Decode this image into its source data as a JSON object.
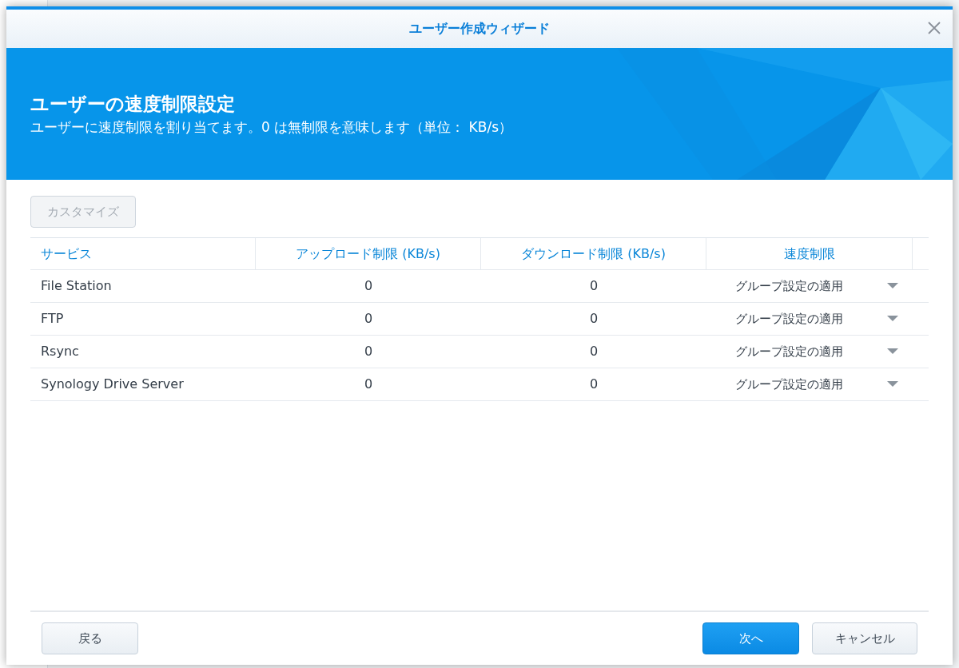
{
  "window": {
    "title": "ユーザー作成ウィザード"
  },
  "header": {
    "title": "ユーザーの速度制限設定",
    "description": "ユーザーに速度制限を割り当てます。0 は無制限を意味します（単位： KB/s）"
  },
  "customize_button": {
    "label": "カスタマイズ",
    "disabled": true
  },
  "table": {
    "columns": [
      "サービス",
      "アップロード制限 (KB/s)",
      "ダウンロード制限 (KB/s)",
      "速度制限"
    ],
    "rows": [
      {
        "service": "File Station",
        "upload": "0",
        "download": "0",
        "speed_limit": "グループ設定の適用"
      },
      {
        "service": "FTP",
        "upload": "0",
        "download": "0",
        "speed_limit": "グループ設定の適用"
      },
      {
        "service": "Rsync",
        "upload": "0",
        "download": "0",
        "speed_limit": "グループ設定の適用"
      },
      {
        "service": "Synology Drive Server",
        "upload": "0",
        "download": "0",
        "speed_limit": "グループ設定の適用"
      }
    ]
  },
  "footer": {
    "back": "戻る",
    "next": "次へ",
    "cancel": "キャンセル"
  }
}
